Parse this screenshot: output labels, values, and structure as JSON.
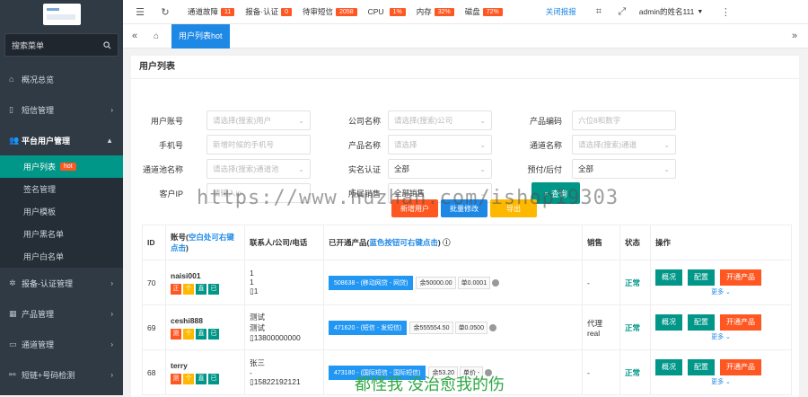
{
  "sidebar": {
    "search_label": "搜索菜单",
    "items": [
      {
        "label": "概况总览",
        "icon": "home-icon"
      },
      {
        "label": "短信管理",
        "icon": "tablet-icon"
      },
      {
        "label": "平台用户管理",
        "icon": "users-icon"
      }
    ],
    "subitems": [
      {
        "label": "用户列表",
        "badge": "hot"
      },
      {
        "label": "签名管理"
      },
      {
        "label": "用户模板"
      },
      {
        "label": "用户黑名单"
      },
      {
        "label": "用户白名单"
      }
    ],
    "items_after": [
      {
        "label": "报备-认证管理",
        "icon": "gear-icon"
      },
      {
        "label": "产品管理",
        "icon": "grid-icon"
      },
      {
        "label": "通道管理",
        "icon": "channel-icon"
      },
      {
        "label": "短链+号码检测",
        "icon": "link-icon"
      }
    ]
  },
  "topbar": {
    "channel_fault": "通道故障",
    "channel_fault_count": "11",
    "report_auth": "报备·认证",
    "report_auth_count": "0",
    "pending_sms": "待审短信",
    "pending_sms_count": "2058",
    "cpu": "CPU",
    "cpu_value": "1%",
    "memory": "内存",
    "memory_value": "32%",
    "disk": "磁盘",
    "disk_value": "72%",
    "close_alert": "关闭报报",
    "user": "admin的姓名111"
  },
  "tab": {
    "label": "用户列表hot"
  },
  "page": {
    "title": "用户列表"
  },
  "form": {
    "account": {
      "label": "用户账号",
      "placeholder": "请选择(搜索)用户"
    },
    "company": {
      "label": "公司名称",
      "placeholder": "请选择(搜索)公司"
    },
    "product_code": {
      "label": "产品编码",
      "placeholder": "六位8和数字"
    },
    "phone": {
      "label": "手机号",
      "placeholder": "新增时候的手机号"
    },
    "product_name": {
      "label": "产品名称",
      "placeholder": "请选择"
    },
    "channel_name": {
      "label": "通道名称",
      "placeholder": "请选择(搜索)通道"
    },
    "channel_pool": {
      "label": "通道池名称",
      "placeholder": "请选择(搜索)通道池"
    },
    "realname": {
      "label": "实名认证",
      "value": "全部"
    },
    "prepay": {
      "label": "预付/后付",
      "value": "全部"
    },
    "client_ip": {
      "label": "客户IP",
      "placeholder": "请输入ip"
    },
    "sales": {
      "label": "所属销售",
      "value": "全部销售"
    },
    "query_button": "查询"
  },
  "actions": [
    "新增用户",
    "批量修改",
    "导出"
  ],
  "table": {
    "headers": {
      "id": "ID",
      "account": "账号(",
      "account_hint": "空白处可右键点击",
      "account_end": ")",
      "contact": "联系人/公司/电话",
      "products": "已开通产品(",
      "products_hint": "蓝色按钮可右键点击",
      "products_end": ")",
      "sales": "销售",
      "status": "状态",
      "ops": "操作"
    },
    "rows": [
      {
        "id": "70",
        "account": "naisi001",
        "flags": [
          "正",
          "个",
          "直",
          "已"
        ],
        "contact": [
          "1",
          "1",
          "1"
        ],
        "product": "508638 - (移动网贷 - 网贷)",
        "balance": "余50000.00",
        "price": "单0.0001",
        "sales": "-",
        "status": "正常"
      },
      {
        "id": "69",
        "account": "ceshi888",
        "flags": [
          "测",
          "个",
          "直",
          "已"
        ],
        "contact": [
          "测试",
          "测试",
          "13800000000"
        ],
        "product": "471620 - (短信 - 发短信)",
        "balance": "余555554.50",
        "price": "单0.0500",
        "sales": "代理real",
        "status": "正常"
      },
      {
        "id": "68",
        "account": "terry",
        "flags": [
          "测",
          "个",
          "直",
          "已"
        ],
        "contact": [
          "张三",
          "-",
          "15822192121"
        ],
        "product": "473180 - (国际短信 - 国际短信)",
        "balance": "余53.20",
        "price": "单价 -",
        "sales": "-",
        "status": "正常"
      }
    ],
    "op_labels": {
      "overview": "概况",
      "config": "配置",
      "open": "开通产品",
      "more": "更多"
    }
  },
  "watermark": "https://www.huzhan.com/ishop19303",
  "footer_text": "都怪我 没治愈我的伤",
  "colors": {
    "sidebar": "#2f3a45",
    "active": "#009688",
    "blue": "#1e88e5",
    "orange": "#ff5722"
  }
}
